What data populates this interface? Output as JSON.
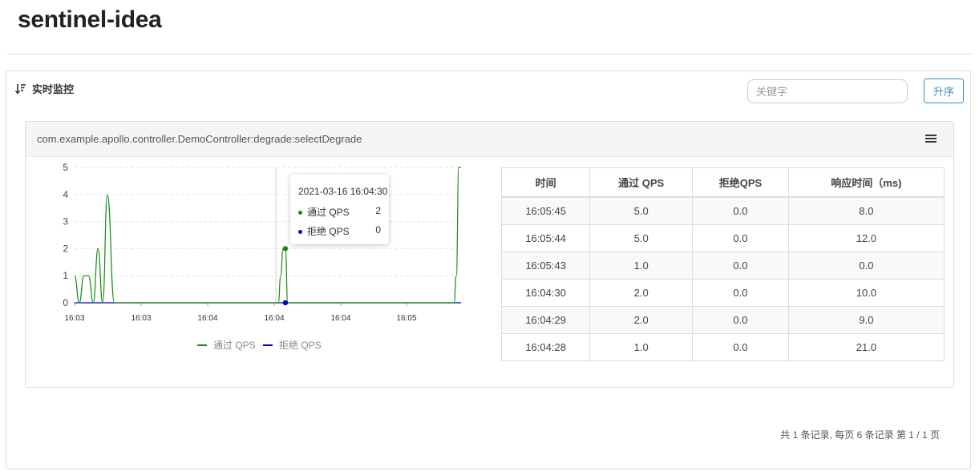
{
  "app": {
    "title": "sentinel-idea"
  },
  "panel": {
    "heading": "实时监控",
    "search_placeholder": "关键字",
    "sort_label": "升序"
  },
  "resource": {
    "name": "com.example.apollo.controller.DemoController:degrade:selectDegrade"
  },
  "tooltip": {
    "time": "2021-03-16 16:04:30",
    "pass_label": "通过 QPS",
    "pass_value": "2",
    "block_label": "拒绝 QPS",
    "block_value": "0"
  },
  "colors": {
    "pass": "#118a11",
    "block": "#0000cc",
    "accent": "#3c8dbc"
  },
  "chart_data": {
    "type": "line",
    "x_tick_labels": [
      "16:03",
      "16:03",
      "16:04",
      "16:04",
      "16:04",
      "16:05"
    ],
    "ylim": [
      0,
      5
    ],
    "y_ticks": [
      0,
      1,
      2,
      3,
      4,
      5
    ],
    "legend": "bottom",
    "grid": "horizontal dashed",
    "series": [
      {
        "name": "通过 QPS",
        "color": "#118a11",
        "points": [
          [
            "16:03:00",
            1
          ],
          [
            "16:03:02",
            0
          ],
          [
            "16:03:04",
            1
          ],
          [
            "16:03:06",
            1
          ],
          [
            "16:03:08",
            0
          ],
          [
            "16:03:10",
            2
          ],
          [
            "16:03:12",
            0
          ],
          [
            "16:03:14",
            4
          ],
          [
            "16:03:17",
            0
          ],
          [
            "16:04:27",
            0
          ],
          [
            "16:04:28",
            1
          ],
          [
            "16:04:29",
            2
          ],
          [
            "16:04:30",
            2
          ],
          [
            "16:04:31",
            0
          ],
          [
            "16:05:42",
            0
          ],
          [
            "16:05:43",
            1
          ],
          [
            "16:05:44",
            5
          ],
          [
            "16:05:45",
            5
          ]
        ]
      },
      {
        "name": "拒绝 QPS",
        "color": "#0000cc",
        "points": [
          [
            "16:03:00",
            0
          ],
          [
            "16:05:45",
            0
          ]
        ]
      }
    ]
  },
  "table": {
    "headers": [
      "时间",
      "通过 QPS",
      "拒绝QPS",
      "响应时间（ms)"
    ],
    "rows": [
      [
        "16:05:45",
        "5.0",
        "0.0",
        "8.0"
      ],
      [
        "16:05:44",
        "5.0",
        "0.0",
        "12.0"
      ],
      [
        "16:05:43",
        "1.0",
        "0.0",
        "0.0"
      ],
      [
        "16:04:30",
        "2.0",
        "0.0",
        "10.0"
      ],
      [
        "16:04:29",
        "2.0",
        "0.0",
        "9.0"
      ],
      [
        "16:04:28",
        "1.0",
        "0.0",
        "21.0"
      ]
    ]
  },
  "pagination": {
    "text": "共 1 条记录, 每页 6 条记录 第 1 / 1 页"
  }
}
